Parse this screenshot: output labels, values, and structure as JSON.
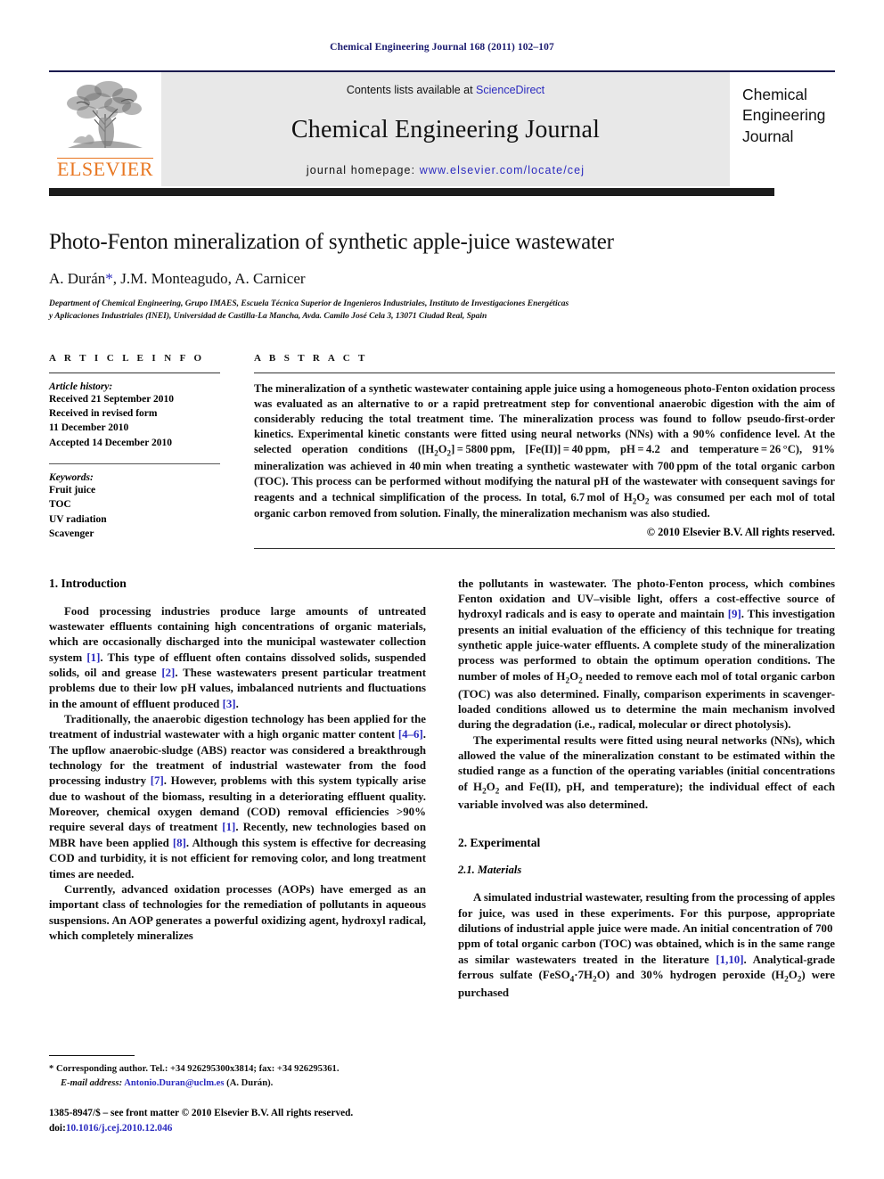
{
  "running_head": "Chemical Engineering Journal 168 (2011) 102–107",
  "masthead": {
    "publisher_name": "ELSEVIER",
    "contents_prefix": "Contents lists available at ",
    "sciencedirect": "ScienceDirect",
    "journal_title": "Chemical Engineering Journal",
    "homepage_prefix": "journal homepage: ",
    "homepage_url": "www.elsevier.com/locate/cej",
    "cover_line1": "Chemical",
    "cover_line2": "Engineering",
    "cover_line3": "Journal",
    "link_color": "#2b2bbf",
    "brand_color": "#E87722"
  },
  "title_block": {
    "title": "Photo-Fenton mineralization of synthetic apple-juice wastewater",
    "authors_pre": "A. Durán",
    "author_star": "*",
    "authors_post": ", J.M. Monteagudo, A. Carnicer",
    "affiliation_line1": "Department of Chemical Engineering, Grupo IMAES, Escuela Técnica Superior de Ingenieros Industriales, Instituto de Investigaciones Energéticas",
    "affiliation_line2": "y Aplicaciones Industriales (INEI), Universidad de Castilla-La Mancha, Avda. Camilo José Cela 3, 13071 Ciudad Real, Spain"
  },
  "article_info": {
    "heading": "A R T I C L E    I N F O",
    "history_label": "Article history:",
    "history_lines": [
      "Received 21 September 2010",
      "Received in revised form",
      "11 December 2010",
      "Accepted 14 December 2010"
    ],
    "keywords_label": "Keywords:",
    "keywords": [
      "Fruit juice",
      "TOC",
      "UV radiation",
      "Scavenger"
    ]
  },
  "abstract": {
    "heading": "A B S T R A C T",
    "paragraphs": [
      "The mineralization of a synthetic wastewater containing apple juice using a homogeneous photo-Fenton oxidation process was evaluated as an alternative to or a rapid pretreatment step for conventional anaerobic digestion with the aim of considerably reducing the total treatment time. The mineralization process was found to follow pseudo-first-order kinetics. Experimental kinetic constants were fitted using neural networks (NNs) with a 90% confidence level. At the selected operation conditions ([H2O2]=5800 ppm, [Fe(II)]=40 ppm, pH=4.2 and temperature=26 °C), 91% mineralization was achieved in 40 min when treating a synthetic wastewater with 700 ppm of the total organic carbon (TOC). This process can be performed without modifying the natural pH of the wastewater with consequent savings for reagents and a technical simplification of the process. In total, 6.7 mol of H2O2 was consumed per each mol of total organic carbon removed from solution. Finally, the mineralization mechanism was also studied."
    ],
    "copyright": "© 2010 Elsevier B.V. All rights reserved."
  },
  "body": {
    "left_column": {
      "section1_heading": "1.  Introduction",
      "p1": "Food processing industries produce large amounts of untreated wastewater effluents containing high concentrations of organic materials, which are occasionally discharged into the municipal wastewater collection system [1]. This type of effluent often contains dissolved solids, suspended solids, oil and grease [2]. These wastewaters present particular treatment problems due to their low pH values, imbalanced nutrients and fluctuations in the amount of effluent produced [3].",
      "p2": "Traditionally, the anaerobic digestion technology has been applied for the treatment of industrial wastewater with a high organic matter content [4–6]. The upflow anaerobic-sludge (ABS) reactor was considered a breakthrough technology for the treatment of industrial wastewater from the food processing industry [7]. However, problems with this system typically arise due to washout of the biomass, resulting in a deteriorating effluent quality. Moreover, chemical oxygen demand (COD) removal efficiencies >90% require several days of treatment [1]. Recently, new technologies based on MBR have been applied [8]. Although this system is effective for decreasing COD and turbidity, it is not efficient for removing color, and long treatment times are needed.",
      "p3": "Currently, advanced oxidation processes (AOPs) have emerged as an important class of technologies for the remediation of pollutants in aqueous suspensions. An AOP generates a powerful oxidizing agent, hydroxyl radical, which completely mineralizes"
    },
    "right_column": {
      "p1": "the pollutants in wastewater. The photo-Fenton process, which combines Fenton oxidation and UV–visible light, offers a cost-effective source of hydroxyl radicals and is easy to operate and maintain [9]. This investigation presents an initial evaluation of the efficiency of this technique for treating synthetic apple juice-water effluents. A complete study of the mineralization process was performed to obtain the optimum operation conditions. The number of moles of H2O2 needed to remove each mol of total organic carbon (TOC) was also determined. Finally, comparison experiments in scavenger-loaded conditions allowed us to determine the main mechanism involved during the degradation (i.e., radical, molecular or direct photolysis).",
      "p2": "The experimental results were fitted using neural networks (NNs), which allowed the value of the mineralization constant to be estimated within the studied range as a function of the operating variables (initial concentrations of H2O2 and Fe(II), pH, and temperature); the individual effect of each variable involved was also determined.",
      "section2_heading": "2.  Experimental",
      "subsection_heading": "2.1.  Materials",
      "p3": "A simulated industrial wastewater, resulting from the processing of apples for juice, was used in these experiments. For this purpose, appropriate dilutions of industrial apple juice were made. An initial concentration of 700 ppm of total organic carbon (TOC) was obtained, which is in the same range as similar wastewaters treated in the literature [1,10]. Analytical-grade ferrous sulfate (FeSO4·7H2O) and 30% hydrogen peroxide (H2O2) were purchased"
    }
  },
  "footnotes": {
    "corresponding_marker": "*",
    "corresponding_text": "Corresponding author. Tel.: +34 926295300x3814; fax: +34 926295361.",
    "email_label": "E-mail address:",
    "email": "Antonio.Duran@uclm.es",
    "email_suffix": "(A. Durán).",
    "issn_line": "1385-8947/$ – see front matter © 2010 Elsevier B.V. All rights reserved.",
    "doi_label": "doi:",
    "doi_value": "10.1016/j.cej.2010.12.046"
  }
}
